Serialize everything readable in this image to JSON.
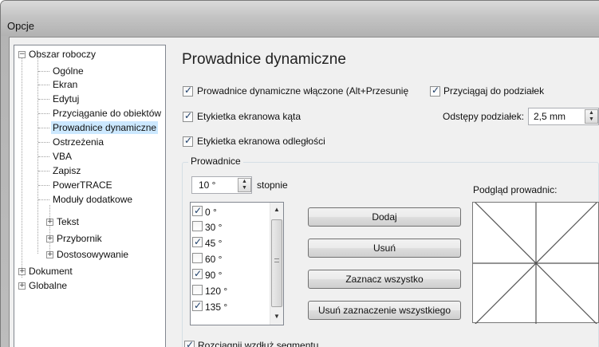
{
  "window": {
    "title": "Opcje"
  },
  "tree": {
    "items": [
      {
        "label": "Obszar roboczy",
        "expander": "−"
      },
      {
        "label": "Ogólne"
      },
      {
        "label": "Ekran"
      },
      {
        "label": "Edytuj"
      },
      {
        "label": "Przyciąganie do obiektów"
      },
      {
        "label": "Prowadnice dynamiczne"
      },
      {
        "label": "Ostrzeżenia"
      },
      {
        "label": "VBA"
      },
      {
        "label": "Zapisz"
      },
      {
        "label": "PowerTRACE"
      },
      {
        "label": "Moduły dodatkowe"
      },
      {
        "label": "Tekst",
        "expander": "+"
      },
      {
        "label": "Przybornik",
        "expander": "+"
      },
      {
        "label": "Dostosowywanie",
        "expander": "+"
      },
      {
        "label": "Dokument",
        "expander": "+"
      },
      {
        "label": "Globalne",
        "expander": "+"
      }
    ]
  },
  "page": {
    "heading": "Prowadnice dynamiczne",
    "enable_guides": {
      "label": "Prowadnice dynamiczne włączone (Alt+Przesunię",
      "checked": true
    },
    "snap_to_ticks": {
      "label": "Przyciągaj do podziałek",
      "checked": true
    },
    "angle_label": {
      "label": "Etykietka ekranowa kąta",
      "checked": true
    },
    "distance_label": {
      "label": "Etykietka ekranowa odległości",
      "checked": true
    },
    "tick_spacing": {
      "label": "Odstępy podziałek:",
      "value": "2,5 mm"
    },
    "group": {
      "title": "Prowadnice",
      "degree_value": "10 °",
      "degree_unit": "stopnie",
      "angles": [
        {
          "label": "0 °",
          "checked": true
        },
        {
          "label": "30 °",
          "checked": false
        },
        {
          "label": "45 °",
          "checked": true
        },
        {
          "label": "60 °",
          "checked": false
        },
        {
          "label": "90 °",
          "checked": true
        },
        {
          "label": "120 °",
          "checked": false
        },
        {
          "label": "135 °",
          "checked": true
        }
      ],
      "buttons": {
        "add": "Dodaj",
        "remove": "Usuń",
        "select_all": "Zaznacz wszystko",
        "deselect_all": "Usuń zaznaczenie wszystkiego"
      },
      "preview_label": "Podgląd prowadnic:",
      "preview_angles": [
        0,
        45,
        90,
        135
      ]
    },
    "extend_along_segment": {
      "label": "Rozciągnij wzdłuż segmentu",
      "checked": true
    }
  },
  "colors": {
    "selection": "#cce8ff",
    "preview_line": "#555555"
  }
}
